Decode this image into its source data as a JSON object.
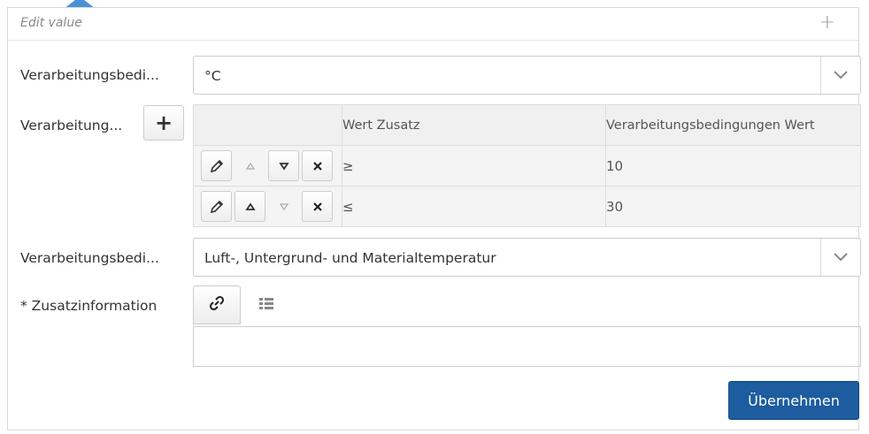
{
  "panel": {
    "title": "Edit value",
    "add_symbol": "+"
  },
  "fields": {
    "unit": {
      "label": "Verarbeitungsbedi...",
      "value": "°C"
    },
    "conditions": {
      "label": "Verarbeitung...",
      "add_symbol": "+",
      "columns": [
        "",
        "Wert Zusatz",
        "Verarbeitungsbedingungen Wert"
      ],
      "rows": [
        {
          "zusatz": "≥",
          "wert": "10"
        },
        {
          "zusatz": "≤",
          "wert": "30"
        }
      ]
    },
    "condition_type": {
      "label": "Verarbeitungsbedi...",
      "value": "Luft-, Untergrund- und Materialtemperatur"
    },
    "additional_info": {
      "label": "* Zusatzinformation",
      "value": ""
    }
  },
  "actions": {
    "submit_label": "Übernehmen"
  },
  "colors": {
    "primary": "#1d5c9e",
    "pointer": "#4a90d9"
  }
}
